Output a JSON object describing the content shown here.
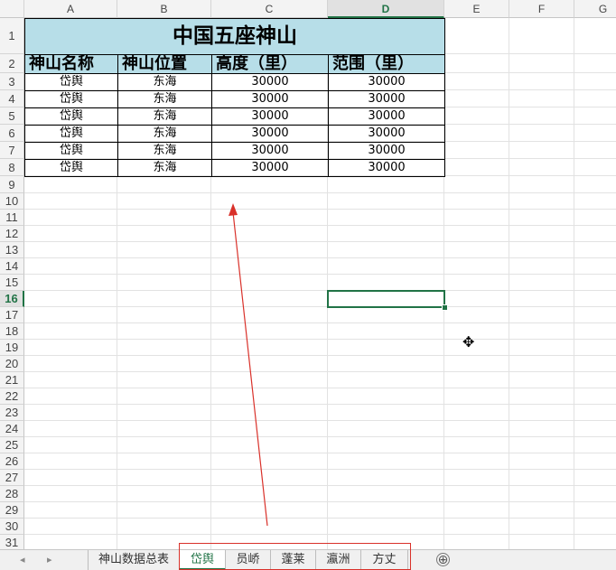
{
  "columns": [
    "A",
    "B",
    "C",
    "D",
    "E",
    "F",
    "G"
  ],
  "selected_column": "D",
  "rows": [
    "1",
    "2",
    "3",
    "4",
    "5",
    "6",
    "7",
    "8",
    "9",
    "10",
    "11",
    "12",
    "13",
    "14",
    "15",
    "16",
    "17",
    "18",
    "19",
    "20",
    "21",
    "22",
    "23",
    "24",
    "25",
    "26",
    "27",
    "28",
    "29",
    "30",
    "31"
  ],
  "selected_row": "16",
  "table": {
    "title": "中国五座神山",
    "headers": [
      "神山名称",
      "神山位置",
      "高度（里）",
      "范围（里）"
    ],
    "data": [
      [
        "岱舆",
        "东海",
        "30000",
        "30000"
      ],
      [
        "岱舆",
        "东海",
        "30000",
        "30000"
      ],
      [
        "岱舆",
        "东海",
        "30000",
        "30000"
      ],
      [
        "岱舆",
        "东海",
        "30000",
        "30000"
      ],
      [
        "岱舆",
        "东海",
        "30000",
        "30000"
      ],
      [
        "岱舆",
        "东海",
        "30000",
        "30000"
      ]
    ],
    "fill_color": "#b7dee8"
  },
  "sheet_tabs": [
    "神山数据总表",
    "岱舆",
    "员峤",
    "蓬莱",
    "瀛洲",
    "方丈"
  ],
  "active_tab": "岱舆",
  "nav_arrows": {
    "prev": "◂",
    "next": "▸"
  },
  "add_sheet": "⊕",
  "cursor_icon": "✥",
  "accent_color": "#217346",
  "annotation_color": "#d9312a"
}
